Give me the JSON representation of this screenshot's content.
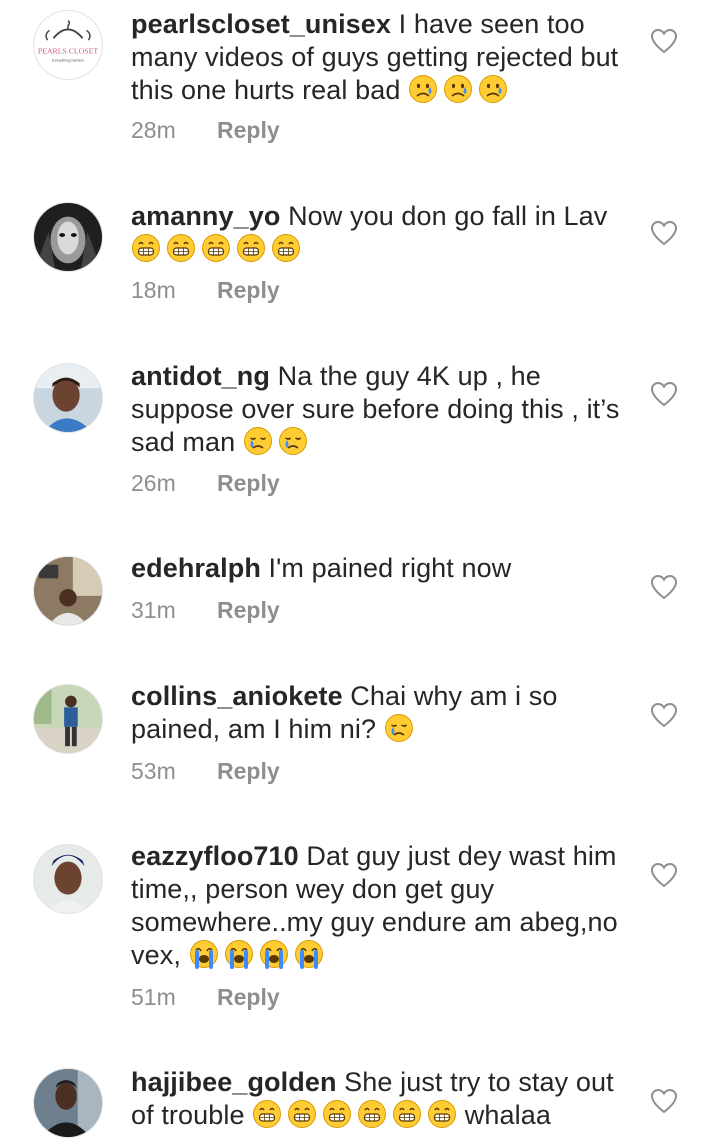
{
  "comments": [
    {
      "username": "pearlscloset_unisex",
      "text": "I have seen too many videos of guys getting rejected but this one hurts real bad",
      "emoji": [
        "sad-tear-face",
        "sad-tear-face",
        "sad-tear-face"
      ],
      "trail": "",
      "time": "28m",
      "reply": "Reply",
      "avatar_text": "PEARLS CLOSET",
      "avatar_subtext": "Everything fashion",
      "avatar_kind": "logo"
    },
    {
      "username": "amanny_yo",
      "text": "Now you don go fall in Lav",
      "emoji": [
        "grin-face",
        "grin-face",
        "grin-face",
        "grin-face",
        "grin-face"
      ],
      "trail": "",
      "time": "18m",
      "reply": "Reply",
      "avatar_kind": "mask"
    },
    {
      "username": "antidot_ng",
      "text": "Na the guy 4K up , he suppose over sure before doing this , it’s sad man",
      "emoji": [
        "crying-face",
        "crying-face"
      ],
      "trail": "",
      "time": "26m",
      "reply": "Reply",
      "avatar_kind": "photo-blue"
    },
    {
      "username": "edehralph",
      "text": "I'm pained right now",
      "emoji": [],
      "trail": "",
      "time": "31m",
      "reply": "Reply",
      "avatar_kind": "photo-room"
    },
    {
      "username": "collins_aniokete",
      "text": "Chai why am i so pained, am I him ni?",
      "emoji": [
        "crying-face"
      ],
      "trail": "",
      "time": "53m",
      "reply": "Reply",
      "avatar_kind": "photo-outdoor"
    },
    {
      "username": "eazzyfloo710",
      "text": "Dat guy just dey wast him time,, person wey don get guy somewhere..my guy endure am abeg,no vex,",
      "emoji": [
        "loud-cry-face",
        "loud-cry-face",
        "loud-cry-face",
        "loud-cry-face"
      ],
      "trail": "",
      "time": "51m",
      "reply": "Reply",
      "avatar_kind": "photo-selfie"
    },
    {
      "username": "hajjibee_golden",
      "text": "She just try to stay out of trouble",
      "emoji": [
        "grin-face",
        "grin-face",
        "grin-face",
        "grin-face",
        "grin-face",
        "grin-face"
      ],
      "trail": "whalaa",
      "time": "",
      "reply": "",
      "avatar_kind": "photo-dark"
    }
  ],
  "colors": {
    "text": "#262626",
    "meta": "#8e8e8e",
    "emoji_face": "#ffcc33",
    "tear": "#3d8bff"
  }
}
